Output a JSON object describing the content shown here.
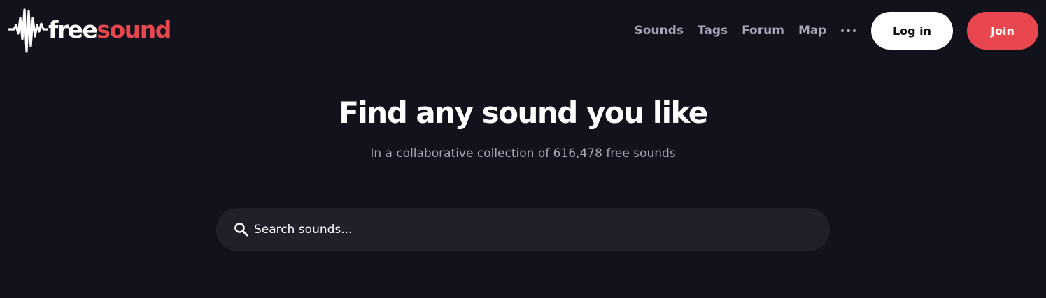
{
  "header": {
    "logo": {
      "part1": "free",
      "part2": "sound",
      "icon": "waveform-icon"
    },
    "nav": {
      "items": [
        {
          "label": "Sounds"
        },
        {
          "label": "Tags"
        },
        {
          "label": "Forum"
        },
        {
          "label": "Map"
        }
      ],
      "more_icon": "more-dots-icon"
    },
    "login_label": "Log in",
    "join_label": "Join"
  },
  "hero": {
    "title": "Find any sound you like",
    "subtitle": "In a collaborative collection of 616,478 free sounds"
  },
  "search": {
    "placeholder": "Search sounds...",
    "value": "",
    "icon": "search-icon"
  },
  "colors": {
    "background": "#12121c",
    "accent": "#e8474f",
    "search_bg": "#20202b",
    "nav_text": "#a7a7b8",
    "white": "#ffffff"
  }
}
